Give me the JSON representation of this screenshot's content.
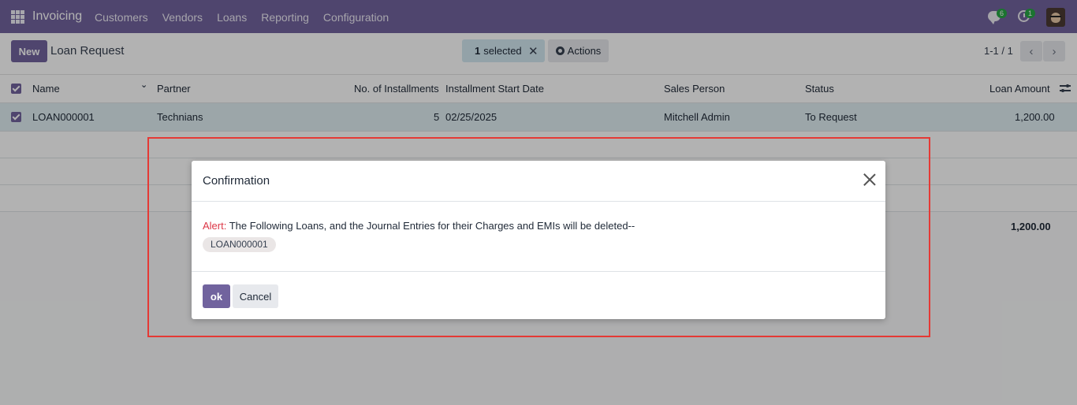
{
  "navbar": {
    "app_name": "Invoicing",
    "menu": [
      "Customers",
      "Vendors",
      "Loans",
      "Reporting",
      "Configuration"
    ],
    "chat_badge": "6",
    "activity_badge": "1",
    "color": "#71639e"
  },
  "control": {
    "new_label": "New",
    "breadcrumb": "Loan Request",
    "selected_count": "1",
    "selected_text": "selected",
    "actions_label": "Actions",
    "pager": "1-1 / 1"
  },
  "table": {
    "columns": [
      "Name",
      "Partner",
      "No. of Installments",
      "Installment Start Date",
      "Sales Person",
      "Status",
      "Loan Amount"
    ],
    "rows": [
      {
        "name": "LOAN000001",
        "partner": "Technians",
        "installments": "5",
        "start_date": "02/25/2025",
        "sales_person": "Mitchell Admin",
        "status": "To Request",
        "amount": "1,200.00"
      }
    ],
    "total": "1,200.00"
  },
  "dialog": {
    "title": "Confirmation",
    "alert_label": "Alert:",
    "alert_text": " The Following Loans, and the Journal Entries for their Charges and EMIs will be deleted--",
    "tag": "LOAN000001",
    "ok_label": "ok",
    "cancel_label": "Cancel"
  }
}
